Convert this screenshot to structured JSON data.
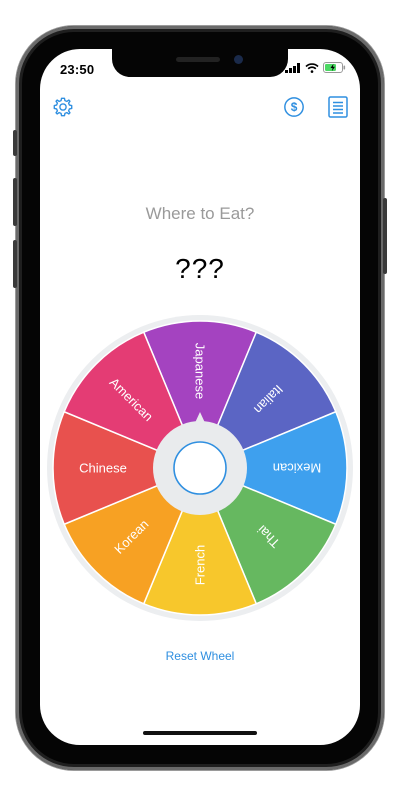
{
  "status_bar": {
    "time": "23:50"
  },
  "toolbar": {
    "settings_icon": "gear-icon",
    "donate_icon": "dollar-circle-icon",
    "list_icon": "list-icon"
  },
  "title": "Where to Eat?",
  "result": "???",
  "wheel": {
    "segments": [
      {
        "label": "Japanese",
        "color": "#a443c0"
      },
      {
        "label": "Italian",
        "color": "#5b65c4"
      },
      {
        "label": "Mexican",
        "color": "#3ea0ee"
      },
      {
        "label": "Thai",
        "color": "#66b860"
      },
      {
        "label": "French",
        "color": "#f7c72c"
      },
      {
        "label": "Korean",
        "color": "#f7a123"
      },
      {
        "label": "Chinese",
        "color": "#e8514e"
      },
      {
        "label": "American",
        "color": "#e43c74"
      }
    ]
  },
  "reset_label": "Reset Wheel",
  "colors": {
    "accent": "#2f8fe0",
    "title_gray": "#9a9a9a",
    "rim": "#eceef0"
  }
}
